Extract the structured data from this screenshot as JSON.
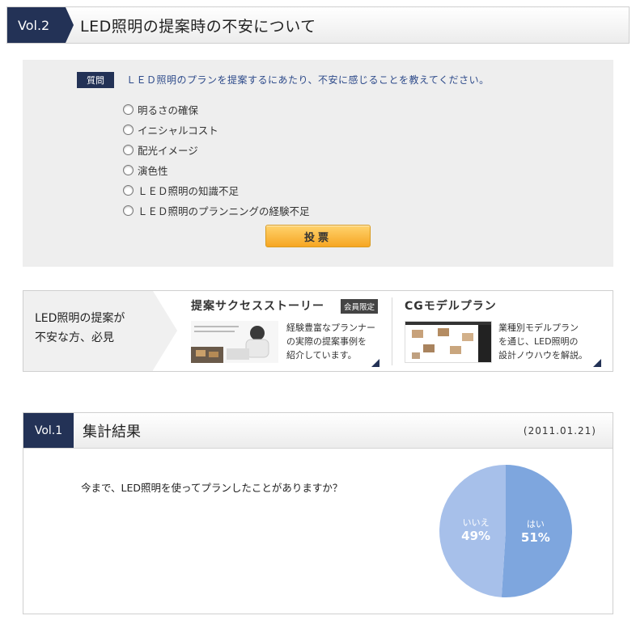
{
  "vol2": {
    "tab": "Vol.2",
    "title": "LED照明の提案時の不安について"
  },
  "poll": {
    "badge": "質問",
    "question": "ＬＥＤ照明のプランを提案するにあたり、不安に感じることを教えてください。",
    "options": [
      "明るさの確保",
      "イニシャルコスト",
      "配光イメージ",
      "演色性",
      "ＬＥＤ照明の知識不足",
      "ＬＥＤ照明のプランニングの経験不足"
    ],
    "vote_label": "投票"
  },
  "banner": {
    "left_line1": "LED照明の提案が",
    "left_line2": "不安な方、必見",
    "story_title": "提案サクセスストーリー",
    "story_badge": "会員限定",
    "story_desc": [
      "経験豊富なプランナー",
      "の実際の提案事例を",
      "紹介しています。"
    ],
    "cg_title": "CGモデルプラン",
    "cg_desc": [
      "業種別モデルプラン",
      "を通じ、LED照明の",
      "設計ノウハウを解説。"
    ]
  },
  "vol1": {
    "tab": "Vol.1",
    "title": "集計結果",
    "date": "(2011.01.21)",
    "question": "今まで、LED照明を使ってプランしたことがありますか？"
  },
  "chart_data": {
    "type": "pie",
    "slices": [
      {
        "label": "はい",
        "value": 51,
        "display": "51%",
        "color": "#7ea6de"
      },
      {
        "label": "いいえ",
        "value": 49,
        "display": "49%",
        "color": "#a7c0ea"
      }
    ]
  },
  "colors": {
    "navy": "#233256",
    "vote_button": "#f6a622",
    "poll_bg": "#eeeeee"
  }
}
